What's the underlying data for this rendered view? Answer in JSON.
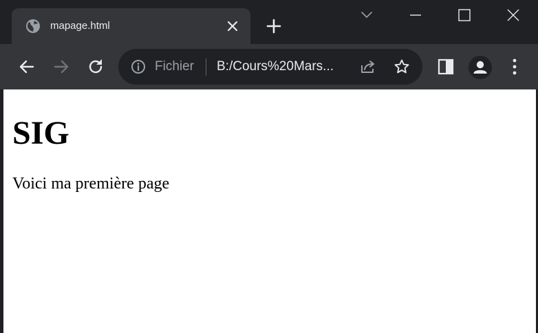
{
  "browser": {
    "tab": {
      "title": "mapage.html",
      "favicon": "globe-icon",
      "close_icon": "close-icon"
    },
    "new_tab_icon": "plus-icon",
    "tab_search_icon": "chevron-down-icon",
    "window_controls": {
      "minimize_icon": "minimize-icon",
      "maximize_icon": "maximize-icon",
      "close_icon": "window-close-icon"
    },
    "toolbar": {
      "back_icon": "arrow-left-icon",
      "forward_icon": "arrow-right-icon",
      "reload_icon": "reload-icon",
      "site_info_icon": "info-icon",
      "scheme_label": "Fichier",
      "url": "B:/Cours%20Mars...",
      "share_icon": "share-icon",
      "bookmark_icon": "star-icon",
      "side_panel_icon": "side-panel-icon",
      "profile_icon": "avatar-icon",
      "menu_icon": "kebab-menu-icon"
    },
    "colors": {
      "frame": "#202124",
      "toolbar": "#35363a",
      "text": "#e8eaed",
      "muted": "#9aa0a6"
    }
  },
  "page": {
    "heading": "SIG",
    "paragraph": "Voici ma première page"
  }
}
